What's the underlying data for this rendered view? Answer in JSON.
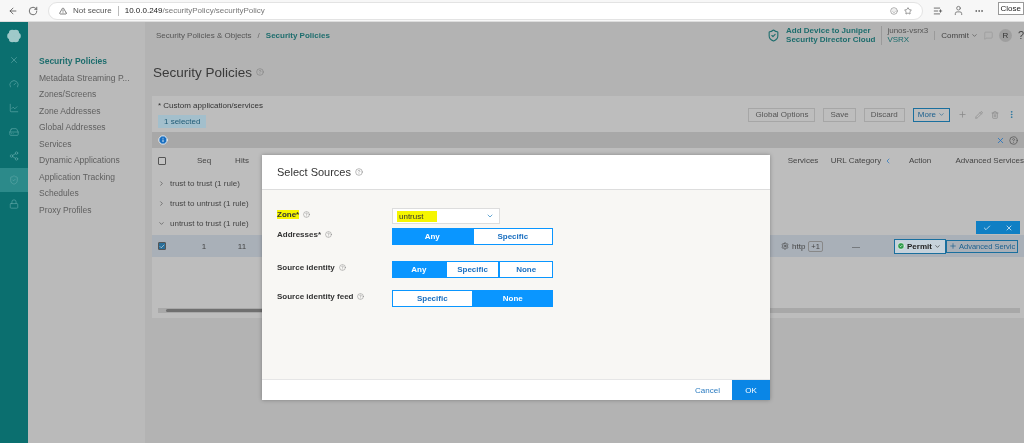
{
  "browser": {
    "security_label": "Not secure",
    "url_host": "10.0.0.249",
    "url_path": "/securityPolicy/securityPolicy",
    "tooltip": "Close"
  },
  "rail": {
    "items": [
      {
        "kind": "close",
        "selected": false
      },
      {
        "kind": "dashboard",
        "selected": false
      },
      {
        "kind": "monitor",
        "selected": false
      },
      {
        "kind": "devices",
        "selected": false
      },
      {
        "kind": "network",
        "selected": false
      },
      {
        "kind": "shield",
        "selected": true
      },
      {
        "kind": "lock",
        "selected": false
      }
    ]
  },
  "sidebar": {
    "items": [
      {
        "label": "Security Policies",
        "selected": true
      },
      {
        "label": "Metadata Streaming P...",
        "selected": false
      },
      {
        "label": "Zones/Screens",
        "selected": false
      },
      {
        "label": "Zone Addresses",
        "selected": false
      },
      {
        "label": "Global Addresses",
        "selected": false
      },
      {
        "label": "Services",
        "selected": false
      },
      {
        "label": "Dynamic Applications",
        "selected": false
      },
      {
        "label": "Application Tracking",
        "selected": false
      },
      {
        "label": "Schedules",
        "selected": false
      },
      {
        "label": "Proxy Profiles",
        "selected": false
      }
    ]
  },
  "header": {
    "breadcrumb": [
      {
        "label": "Security Policies & Objects",
        "selected": false
      },
      {
        "label": "Security Policies",
        "selected": true
      }
    ],
    "separator": "/",
    "promo": [
      "Add Device to Juniper",
      "Security Director Cloud"
    ],
    "device": {
      "name": "junos-vsrx3",
      "model": "VSRX"
    },
    "commit": "Commit",
    "avatar": "R",
    "help": "?"
  },
  "title": "Security Policies",
  "grid": {
    "note": "* Custom application/services",
    "selection": "1 selected",
    "actions": [
      "Global Options",
      "Save",
      "Discard"
    ],
    "more": "More",
    "select_all": {
      "checked": false
    },
    "columns": [
      "Seq",
      "Hits",
      "Services",
      "URL Category",
      "Action",
      "Advanced Services"
    ],
    "groups": [
      {
        "label": "trust to trust (1 rule)",
        "expanded": false
      },
      {
        "label": "trust to untrust (1 rule)",
        "expanded": false
      },
      {
        "label": "untrust to trust (1 rule)",
        "expanded": true
      }
    ],
    "row": {
      "checked": true,
      "seq": "1",
      "hits": "11",
      "service": "http",
      "extra": "+1",
      "url_category": "—",
      "action": "Permit",
      "advanced": "Advanced Servic"
    }
  },
  "dialog": {
    "title": "Select Sources",
    "fields": [
      {
        "label": "Zone*",
        "kind": "select",
        "value": "untrust",
        "highlighted": true
      },
      {
        "label": "Addresses*",
        "kind": "toggle",
        "options": [
          {
            "label": "Any",
            "selected": true
          },
          {
            "label": "Specific",
            "selected": false
          }
        ]
      },
      {
        "label": "Source identity",
        "kind": "toggle",
        "options": [
          {
            "label": "Any",
            "selected": true
          },
          {
            "label": "Specific",
            "selected": false
          },
          {
            "label": "None",
            "selected": false
          }
        ]
      },
      {
        "label": "Source identity feed",
        "kind": "toggle",
        "options": [
          {
            "label": "Specific",
            "selected": false
          },
          {
            "label": "None",
            "selected": true
          }
        ]
      }
    ],
    "cancel": "Cancel",
    "ok": "OK"
  }
}
